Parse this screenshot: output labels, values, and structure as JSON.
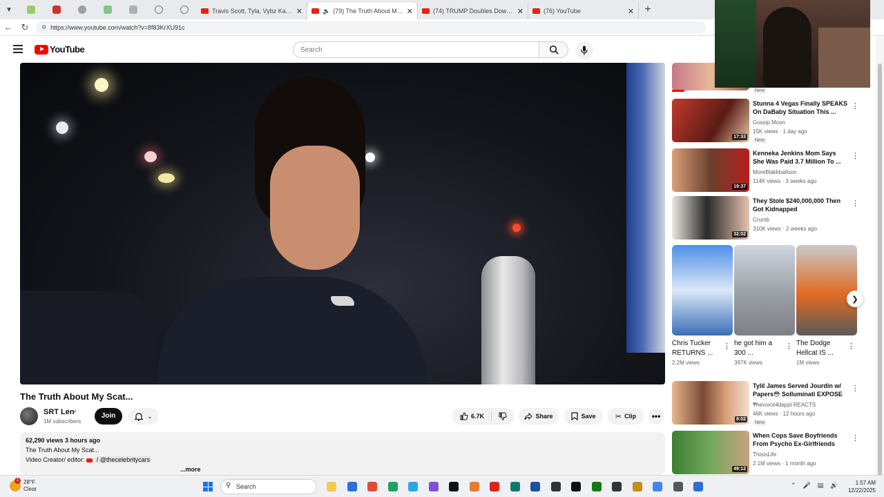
{
  "browser": {
    "tabs": [
      {
        "label": "Travis Scott, Tyla, Vybz Kartel - PBT",
        "active": false
      },
      {
        "label": "(79) The Truth About My Scat...",
        "active": true
      },
      {
        "label": "(74) TRUMP Doubles Down On TA...",
        "active": false
      },
      {
        "label": "(76) YouTube",
        "active": false
      }
    ],
    "new_tab": "+",
    "url": "https://www.youtube.com/watch?v=8f83KrXU91c"
  },
  "header": {
    "logo_text": "YouTube",
    "search_placeholder": "Search"
  },
  "video": {
    "title": "The Truth About My Scat...",
    "channel_name": "SRT Len",
    "channel_subs": "1M subscribers",
    "join_label": "Join",
    "like_count": "6.7K",
    "share_label": "Share",
    "save_label": "Save",
    "clip_label": "Clip",
    "more_label": "•••",
    "description": {
      "stats": "62,290 views  3 hours ago",
      "line1": "The Truth About My Scat...",
      "line2_prefix": "Video Creator/ editor:",
      "line2_handle": "/ @thecelebritycars",
      "more": "...more"
    }
  },
  "recommendations": [
    {
      "title": "Stunna 4 Vegas Finally SPEAKS On DaBaby Situation  This ...",
      "channel": "Gossip Moon",
      "meta": "15K views · 1 day ago",
      "duration": "17:33",
      "badge": "New",
      "thumb_color": "#8a2a22"
    },
    {
      "title": "Kenneka Jenkins Mom Says She Was Paid 3.7 Million To ...",
      "channel": "MoreBlakkballoon",
      "meta": "114K views · 3 weeks ago",
      "duration": "19:37",
      "badge": "",
      "thumb_color": "#5c3a2c"
    },
    {
      "title": "They Stole $240,000,000 Then Got Kidnapped",
      "channel": "Crumb",
      "meta": "310K views · 2 weeks ago",
      "duration": "32:02",
      "badge": "",
      "thumb_color": "#6b6f78"
    },
    {
      "title": "Tylil James Served Jourdin w/ Papers😳 Solluminati EXPOSE ...",
      "channel": "Thevoice4dappl REACTS",
      "meta": "46K views · 12 hours ago",
      "duration": "8:02",
      "badge": "New",
      "thumb_color": "#c98a5e"
    },
    {
      "title": "When Cops Save Boyfriends From Psycho Ex-Girlfriends",
      "channel": "ThisIsLife",
      "meta": "2.1M views · 1 month ago",
      "duration": "49:12",
      "badge": "",
      "thumb_color": "#4d8a3e"
    }
  ],
  "top_rec_badge": "New",
  "shorts": [
    {
      "title": "Chris Tucker RETURNS ...",
      "views": "2.2M views",
      "thumb_color": "#3a7bd5"
    },
    {
      "title": "he got him a 300 ...",
      "views": "397K views",
      "thumb_color": "#9a9fa6"
    },
    {
      "title": "The Dodge Hellcat IS ...",
      "views": "1M views",
      "thumb_color": "#d8641c"
    }
  ],
  "taskbar": {
    "weather_temp": "28°F",
    "weather_desc": "Clear",
    "weather_badge": "1",
    "search_label": "Search",
    "time": "1:57 AM",
    "date": "12/22/2025",
    "apps": [
      "#f7c948",
      "#2e6fd8",
      "#e34a2f",
      "#1ea362",
      "#2aa9e0",
      "#7b52d6",
      "#111111",
      "#e87a2d",
      "#e62117",
      "#0e7a6b",
      "#1b4fa8",
      "#333333",
      "#111111",
      "#137a13",
      "#333333",
      "#c48f12",
      "#4285f4",
      "#555555",
      "#2f6fd1"
    ]
  }
}
